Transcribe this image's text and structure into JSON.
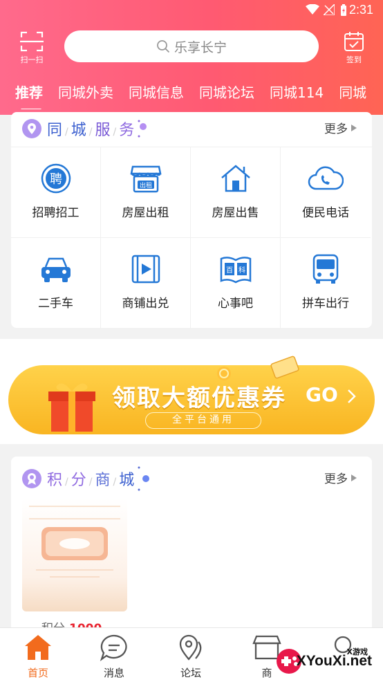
{
  "status_bar": {
    "time": "2:31"
  },
  "header": {
    "scan_label": "扫一扫",
    "search_text": "乐享长宁",
    "sign_label": "签到",
    "tabs": [
      "推荐",
      "同城外卖",
      "同城信息",
      "同城论坛",
      "同城114",
      "同城"
    ]
  },
  "services": {
    "title_chars": [
      "同",
      "城",
      "服",
      "务"
    ],
    "more": "更多",
    "items": [
      {
        "label": "招聘招工",
        "icon": "recruit-icon"
      },
      {
        "label": "房屋出租",
        "icon": "rent-shop-icon"
      },
      {
        "label": "房屋出售",
        "icon": "house-icon"
      },
      {
        "label": "便民电话",
        "icon": "phone-icon"
      },
      {
        "label": "二手车",
        "icon": "car-icon"
      },
      {
        "label": "商铺出兑",
        "icon": "video-icon"
      },
      {
        "label": "心事吧",
        "icon": "encyclopedia-icon"
      },
      {
        "label": "拼车出行",
        "icon": "bus-icon"
      }
    ]
  },
  "banner": {
    "title": "领取大额优惠券",
    "go": "GO",
    "subtitle": "全平台通用"
  },
  "points_mall": {
    "title_chars": [
      "积",
      "分",
      "商",
      "城"
    ],
    "more": "更多",
    "product": {
      "price_label": "积分",
      "price_value": "1000"
    }
  },
  "bottom_nav": [
    {
      "label": "首页",
      "icon": "home-icon",
      "active": true
    },
    {
      "label": "消息",
      "icon": "message-icon",
      "active": false
    },
    {
      "label": "论坛",
      "icon": "location-icon",
      "active": false
    },
    {
      "label": "商",
      "icon": "shop-icon",
      "active": false
    },
    {
      "label": "",
      "icon": "search-icon",
      "active": false
    }
  ],
  "watermark": {
    "small": "X游戏",
    "large": "XYouXi.net"
  },
  "colors": {
    "brand_pink": "#ff5a72",
    "accent_purple": "#8f6ae0",
    "icon_blue": "#2478d6",
    "active_orange": "#f26b1d",
    "price_red": "#e8232f",
    "banner_yellow": "#f9b522"
  }
}
